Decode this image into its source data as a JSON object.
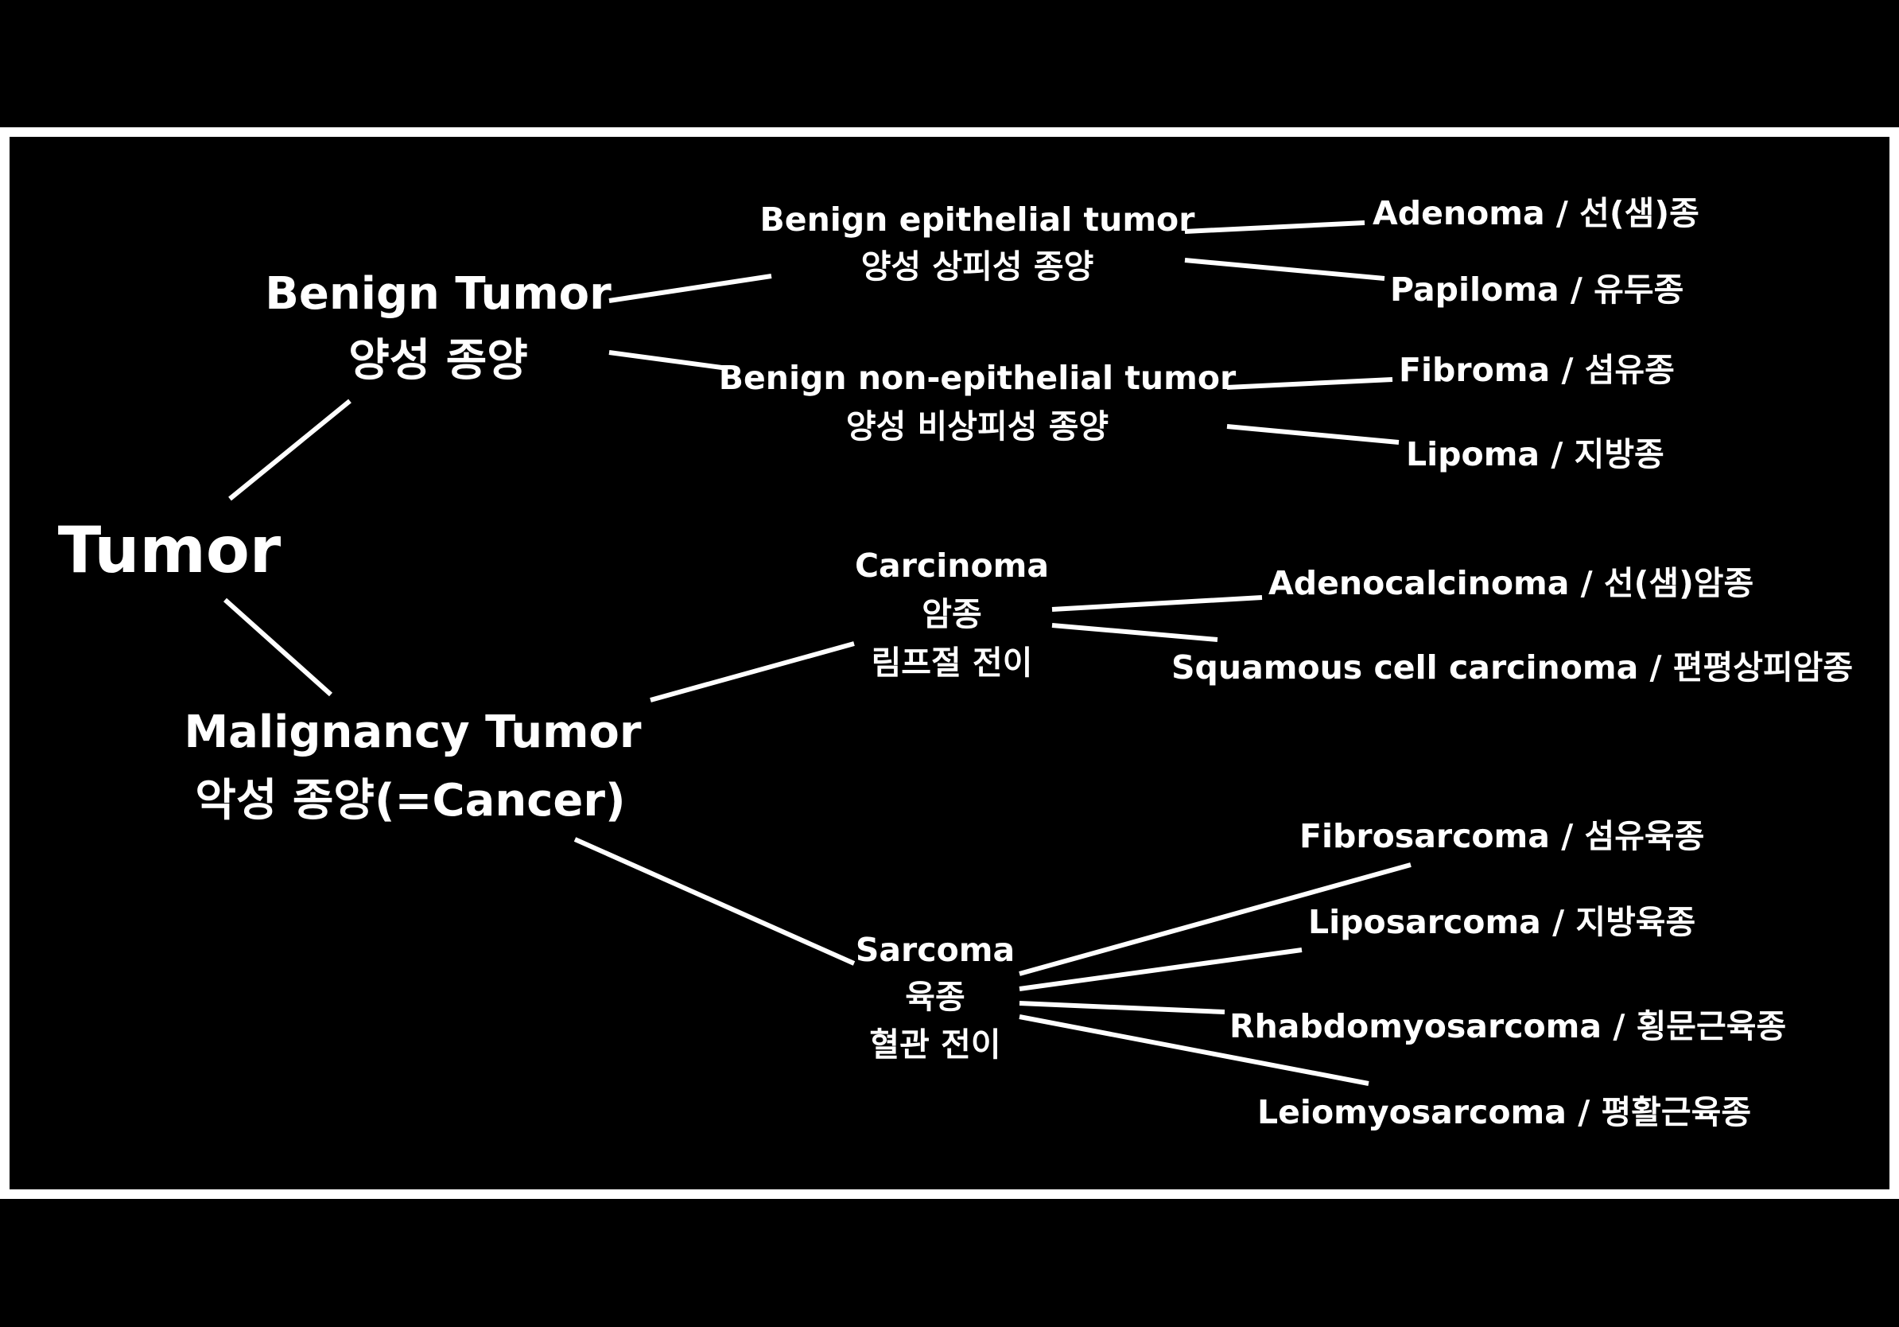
{
  "colors": {
    "background": "#000000",
    "frame": "#ffffff",
    "text": "#ffffff",
    "lines": "#ffffff"
  },
  "root": {
    "label": "Tumor"
  },
  "benign": {
    "en": "Benign Tumor",
    "ko": "양성 종양",
    "epithelial": {
      "en": "Benign epithelial tumor",
      "ko": "양성 상피성 종양",
      "children": [
        "Adenoma / 선(샘)종",
        "Papiloma / 유두종"
      ]
    },
    "non_epithelial": {
      "en": "Benign non-epithelial tumor",
      "ko": "양성 비상피성 종양",
      "children": [
        "Fibroma / 섬유종",
        "Lipoma / 지방종"
      ]
    }
  },
  "malignant": {
    "en": "Malignancy Tumor",
    "ko": "악성 종양(=Cancer)",
    "carcinoma": {
      "en": "Carcinoma",
      "ko": "암종",
      "note": "림프절 전이",
      "children": [
        "Adenocalcinoma / 선(샘)암종",
        "Squamous cell carcinoma / 편평상피암종"
      ]
    },
    "sarcoma": {
      "en": "Sarcoma",
      "ko": "육종",
      "note": "혈관 전이",
      "children": [
        "Fibrosarcoma / 섬유육종",
        "Liposarcoma / 지방육종",
        "Rhabdomyosarcoma / 횡문근육종",
        "Leiomyosarcoma / 평활근육종"
      ]
    }
  }
}
